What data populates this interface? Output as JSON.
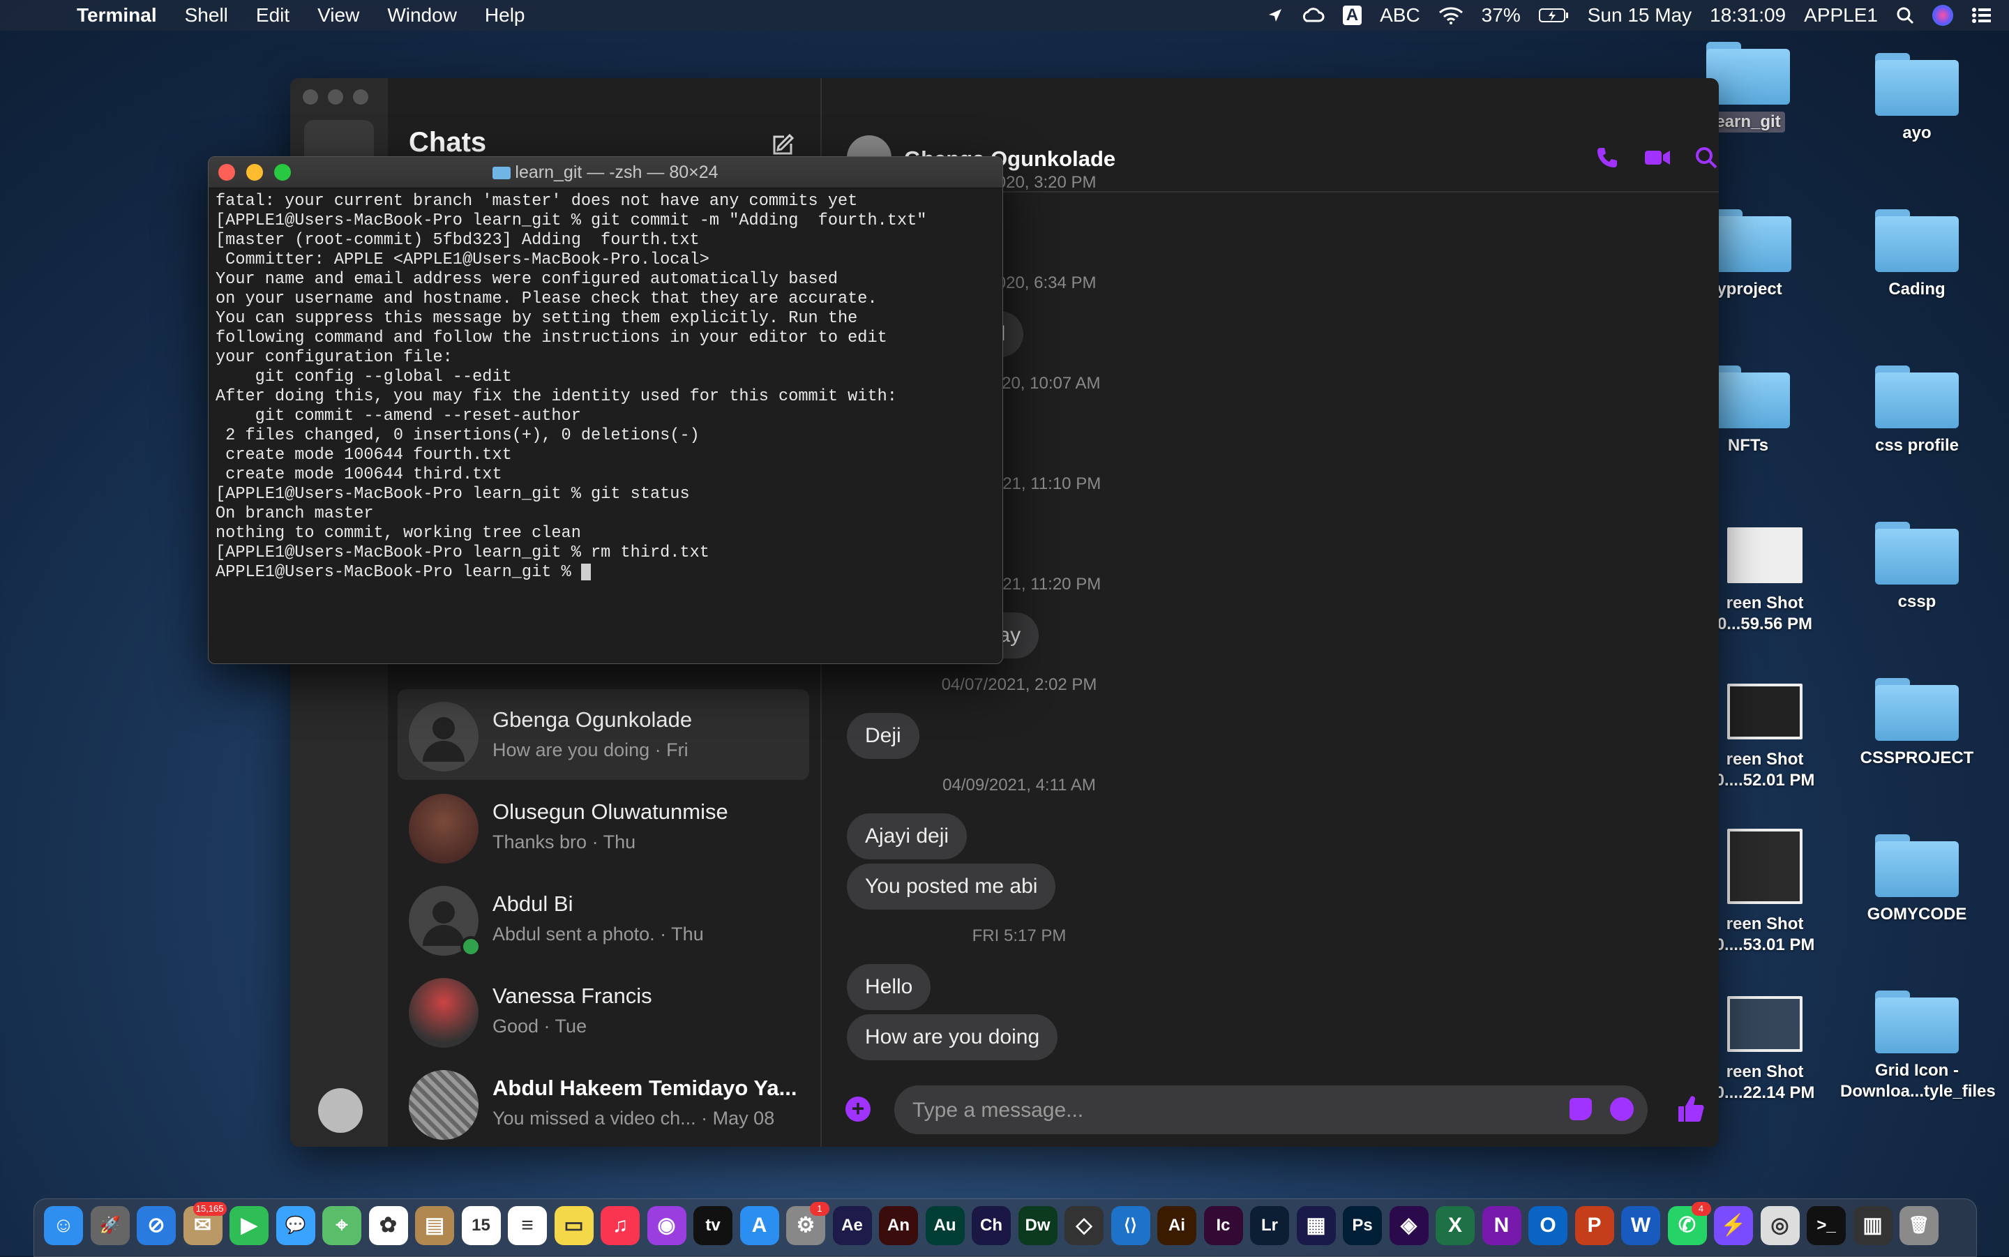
{
  "menubar": {
    "apple_glyph": "",
    "app_name": "Terminal",
    "items": [
      "Shell",
      "Edit",
      "View",
      "Window",
      "Help"
    ],
    "input_badge": "A",
    "input_source": "ABC",
    "battery": "37%",
    "date": "Sun 15 May",
    "time": "18:31:09",
    "user": "APPLE1"
  },
  "desktop": {
    "items": [
      {
        "label": "earn_git",
        "kind": "folder"
      },
      {
        "label": "ayo",
        "kind": "folder"
      },
      {
        "label": "yproject",
        "kind": "folder"
      },
      {
        "label": "Cading",
        "kind": "folder"
      },
      {
        "label": "NFTs",
        "kind": "folder"
      },
      {
        "label": "css profile",
        "kind": "folder"
      },
      {
        "label": "reen Shot\n0...59.56 PM",
        "kind": "screenshot"
      },
      {
        "label": "cssp",
        "kind": "folder"
      },
      {
        "label": "reen Shot\n0....52.01 PM",
        "kind": "screenshot"
      },
      {
        "label": "CSSPROJECT",
        "kind": "folder"
      },
      {
        "label": "reen Shot\n0....53.01 PM",
        "kind": "screenshot"
      },
      {
        "label": "GOMYCODE",
        "kind": "folder"
      },
      {
        "label": "reen Shot\n0....22.14 PM",
        "kind": "screenshot"
      },
      {
        "label": "Grid Icon -\nDownloa...tyle_files",
        "kind": "folder"
      }
    ]
  },
  "messenger": {
    "chats_title": "Chats",
    "chats": [
      {
        "name": "Gbenga Ogunkolade",
        "preview": "How are you doing · Fri",
        "active": true
      },
      {
        "name": "Olusegun Oluwatunmise",
        "preview": "Thanks bro · Thu"
      },
      {
        "name": "Abdul Bi",
        "preview": "Abdul sent a photo. · Thu",
        "online": true
      },
      {
        "name": "Vanessa Francis",
        "preview": "Good · Tue"
      },
      {
        "name": "Abdul Hakeem Temidayo Ya...",
        "preview": "You missed a video ch...  · May 08"
      }
    ],
    "conversation": {
      "name": "Gbenga Ogunkolade",
      "timestamps": [
        "11/08/2020, 3:20 PM",
        "11/08/2020, 6:34 PM",
        "11/12/2020, 10:07 AM",
        "02/08/2021, 11:10 PM",
        "03/06/2021, 11:20 PM",
        "04/07/2021, 2:02 PM",
        "04/09/2021, 4:11 AM",
        "FRI 5:17 PM"
      ],
      "bubbles": [
        "my call",
        "esterday",
        "Deji",
        "Ajayi deji",
        "You posted me abi",
        "Hello",
        "How are you doing"
      ],
      "composer_placeholder": "Type a message..."
    },
    "accent_color": "#a033ff"
  },
  "terminal": {
    "title": "learn_git — -zsh — 80×24",
    "lines": [
      "fatal: your current branch 'master' does not have any commits yet",
      "[APPLE1@Users-MacBook-Pro learn_git % git commit -m \"Adding  fourth.txt\"",
      "[master (root-commit) 5fbd323] Adding  fourth.txt",
      " Committer: APPLE <APPLE1@Users-MacBook-Pro.local>",
      "Your name and email address were configured automatically based",
      "on your username and hostname. Please check that they are accurate.",
      "You can suppress this message by setting them explicitly. Run the",
      "following command and follow the instructions in your editor to edit",
      "your configuration file:",
      "",
      "    git config --global --edit",
      "",
      "After doing this, you may fix the identity used for this commit with:",
      "",
      "    git commit --amend --reset-author",
      "",
      " 2 files changed, 0 insertions(+), 0 deletions(-)",
      " create mode 100644 fourth.txt",
      " create mode 100644 third.txt",
      "[APPLE1@Users-MacBook-Pro learn_git % git status",
      "On branch master",
      "nothing to commit, working tree clean",
      "[APPLE1@Users-MacBook-Pro learn_git % rm third.txt",
      "APPLE1@Users-MacBook-Pro learn_git % "
    ]
  },
  "dock": {
    "apps": [
      {
        "name": "finder",
        "color": "#2f8ff0",
        "glyph": "☺"
      },
      {
        "name": "launchpad",
        "color": "#666",
        "glyph": "🚀"
      },
      {
        "name": "safari",
        "color": "#2a7be0",
        "glyph": "⊘"
      },
      {
        "name": "mail",
        "color": "#bb9966",
        "glyph": "✉",
        "badge": "15,165"
      },
      {
        "name": "facetime",
        "color": "#2fbd55",
        "glyph": "▶"
      },
      {
        "name": "messages",
        "color": "#3aa2ff",
        "glyph": "💬"
      },
      {
        "name": "maps",
        "color": "#5abd6a",
        "glyph": "⌖"
      },
      {
        "name": "photos",
        "color": "#fff",
        "glyph": "✿"
      },
      {
        "name": "contacts",
        "color": "#b08850",
        "glyph": "▤"
      },
      {
        "name": "calendar",
        "color": "#fff",
        "glyph": "15"
      },
      {
        "name": "reminders",
        "color": "#fff",
        "glyph": "≡"
      },
      {
        "name": "notes",
        "color": "#f5d74a",
        "glyph": "▭"
      },
      {
        "name": "music",
        "color": "#fa3550",
        "glyph": "♫"
      },
      {
        "name": "podcasts",
        "color": "#9a3ee0",
        "glyph": "◉"
      },
      {
        "name": "tv",
        "color": "#111",
        "glyph": "tv"
      },
      {
        "name": "app-store",
        "color": "#2a8ff0",
        "glyph": "A"
      },
      {
        "name": "system-preferences",
        "color": "#888",
        "glyph": "⚙",
        "badge": "1"
      },
      {
        "name": "after-effects",
        "color": "#1d1b4a",
        "glyph": "Ae"
      },
      {
        "name": "animate",
        "color": "#3a0c0c",
        "glyph": "An"
      },
      {
        "name": "audition",
        "color": "#003d34",
        "glyph": "Au"
      },
      {
        "name": "character-animator",
        "color": "#1b1745",
        "glyph": "Ch"
      },
      {
        "name": "dreamweaver",
        "color": "#0b3a1f",
        "glyph": "Dw"
      },
      {
        "name": "sketch",
        "color": "#333",
        "glyph": "◇"
      },
      {
        "name": "vscode",
        "color": "#1e72c8",
        "glyph": "⟨⟩"
      },
      {
        "name": "illustrator",
        "color": "#3b1b00",
        "glyph": "Ai"
      },
      {
        "name": "incopy",
        "color": "#330a33",
        "glyph": "Ic"
      },
      {
        "name": "lightroom",
        "color": "#0b1e33",
        "glyph": "Lr"
      },
      {
        "name": "media-encoder",
        "color": "#1a1a4a",
        "glyph": "▦"
      },
      {
        "name": "photoshop",
        "color": "#001e36",
        "glyph": "Ps"
      },
      {
        "name": "premiere",
        "color": "#2a0a4a",
        "glyph": "◈"
      },
      {
        "name": "excel",
        "color": "#1e7045",
        "glyph": "X"
      },
      {
        "name": "onenote",
        "color": "#7719aa",
        "glyph": "N"
      },
      {
        "name": "outlook",
        "color": "#0a64c4",
        "glyph": "O"
      },
      {
        "name": "powerpoint",
        "color": "#c43e1c",
        "glyph": "P"
      },
      {
        "name": "word",
        "color": "#185abd",
        "glyph": "W"
      },
      {
        "name": "whatsapp",
        "color": "#25d366",
        "glyph": "✆",
        "badge": "4"
      },
      {
        "name": "messenger",
        "color": "#7a4cff",
        "glyph": "⚡"
      },
      {
        "name": "chrome",
        "color": "#ddd",
        "glyph": "◎"
      },
      {
        "name": "terminal",
        "color": "#111",
        "glyph": ">_"
      },
      {
        "name": "downloads",
        "color": "#333",
        "glyph": "▥"
      },
      {
        "name": "trash",
        "color": "#8a8a8a",
        "glyph": "🗑"
      }
    ]
  }
}
